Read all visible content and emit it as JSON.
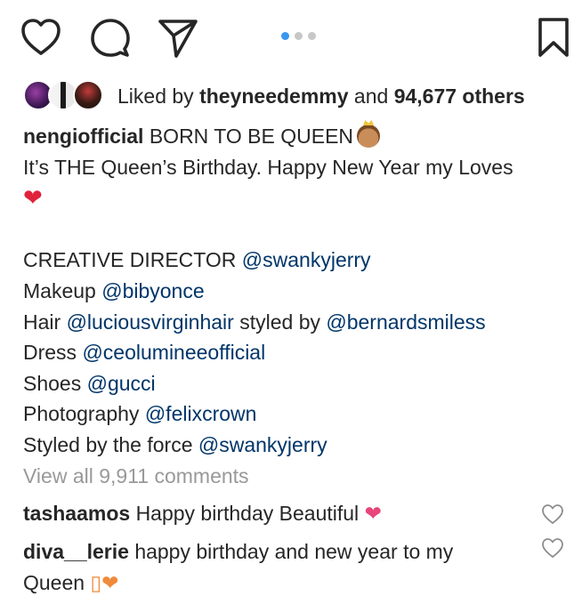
{
  "actions": {
    "like_icon": "heart-outline",
    "comment_icon": "comment-bubble",
    "share_icon": "paper-plane",
    "save_icon": "bookmark",
    "carousel_dots": 3,
    "carousel_active": 1
  },
  "likes": {
    "prefix": "Liked by",
    "user": "theyneedemmy",
    "connector": "and",
    "count": "94,677 others"
  },
  "caption": {
    "username": "nengiofficial",
    "title": "BORN TO BE QUEEN",
    "line2": "It’s THE Queen’s Birthday. Happy New Year my Loves",
    "heart": "❤",
    "credits": [
      {
        "label": "CREATIVE DIRECTOR",
        "mention": "@swankyjerry"
      },
      {
        "label": "Makeup",
        "mention": "@bibyonce"
      },
      {
        "label": "Hair",
        "mention": "@luciousvirginhair",
        "mid": "styled by",
        "mention2": "@bernardsmiless"
      },
      {
        "label": "Dress",
        "mention": "@ceolumineeofficial"
      },
      {
        "label": "Shoes",
        "mention": "@gucci"
      },
      {
        "label": "Photography",
        "mention": "@felixcrown"
      },
      {
        "label": "Styled by the force",
        "mention": "@swankyjerry"
      }
    ]
  },
  "view_all": "View all 9,911 comments",
  "comments": [
    {
      "username": "tashaamos",
      "text": "Happy birthday Beautiful",
      "emoji": "❤"
    },
    {
      "username": "diva__lerie",
      "text": "happy birthday and new year to my",
      "text2": "Queen",
      "emoji": "▯❤"
    }
  ],
  "colors": {
    "text": "#262626",
    "mention": "#003569",
    "muted": "#999999",
    "active_dot": "#3897f0"
  }
}
